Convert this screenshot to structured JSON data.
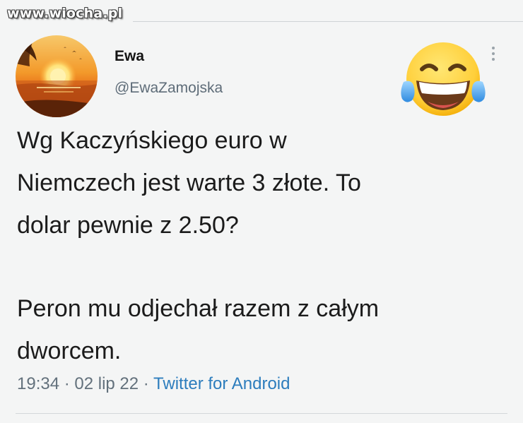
{
  "watermark": "www.wiocha.pl",
  "tweet": {
    "display_name": "Ewa",
    "handle": "@EwaZamojska",
    "text_line1": "Wg Kaczyńskiego euro w",
    "text_line2": "Niemczech jest warte 3 złote. To",
    "text_line3": "dolar pewnie z 2.50?",
    "text_line4": "Peron mu odjechał razem z całym",
    "text_line5": "dworcem.",
    "time": "19:34",
    "separator": " · ",
    "date": "02 lip 22",
    "source": "Twitter for Android"
  },
  "icons": {
    "avatar": "sunset-photo-avatar",
    "reaction": "tears-of-joy-emoji",
    "menu": "more-options-icon"
  },
  "colors": {
    "background": "#f4f5f5",
    "text": "#1b1b1b",
    "secondary": "#63717c",
    "link": "#2d7dbd"
  }
}
